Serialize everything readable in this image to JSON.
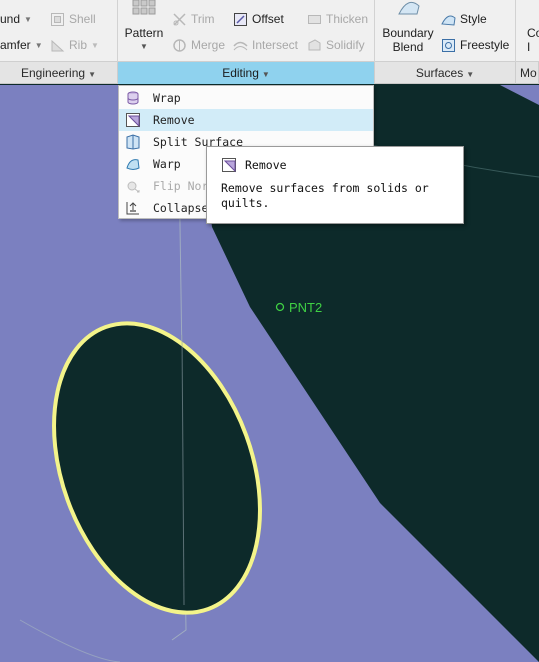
{
  "ribbon": {
    "col1": {
      "round": "und",
      "chamfer": "amfer"
    },
    "shell": "Shell",
    "rib": "Rib",
    "pattern": "Pattern",
    "trim": "Trim",
    "merge": "Merge",
    "offset": "Offset",
    "intersect": "Intersect",
    "thicken": "Thicken",
    "solidify": "Solidify",
    "boundary_blend_1": "Boundary",
    "boundary_blend_2": "Blend",
    "style": "Style",
    "freestyle": "Freestyle",
    "edge_1": "Co",
    "edge_2": "I"
  },
  "groups": {
    "engineering": "Engineering",
    "editing": "Editing",
    "surfaces": "Surfaces",
    "model": "Mo"
  },
  "menu": {
    "items": [
      {
        "label": "Wrap",
        "icon": "wrap-icon"
      },
      {
        "label": "Remove",
        "icon": "remove-icon"
      },
      {
        "label": "Split Surface",
        "icon": "split-surface-icon"
      },
      {
        "label": "Warp",
        "icon": "warp-icon"
      },
      {
        "label": "Flip Nor",
        "icon": "flip-normals-icon"
      },
      {
        "label": "Collapse",
        "icon": "collapse-icon"
      }
    ]
  },
  "tooltip": {
    "title": "Remove",
    "description": "Remove surfaces from solids or quilts."
  },
  "viewport": {
    "point_label": "PNT2",
    "colors": {
      "background_dark": "#0d2a2a",
      "surface": "#7b80c0",
      "highlight_edge": "#f4f48a",
      "point": "#3fd044"
    }
  }
}
